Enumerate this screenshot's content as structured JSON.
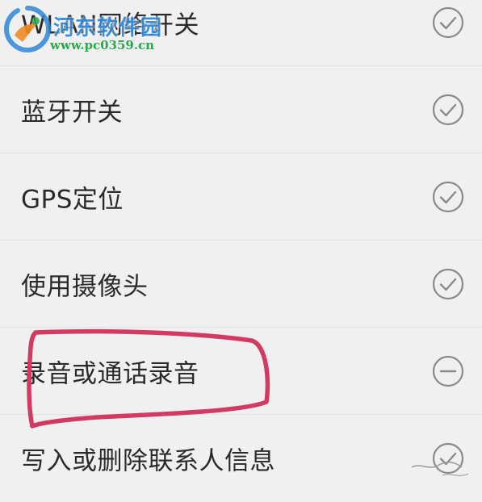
{
  "permissions": {
    "items": [
      {
        "label": "WLAN网络开关",
        "status": "allowed",
        "icon": "check-circle-icon"
      },
      {
        "label": "蓝牙开关",
        "status": "allowed",
        "icon": "check-circle-icon"
      },
      {
        "label": "GPS定位",
        "status": "allowed",
        "icon": "check-circle-icon"
      },
      {
        "label": "使用摄像头",
        "status": "allowed",
        "icon": "check-circle-icon"
      },
      {
        "label": "录音或通话录音",
        "status": "denied",
        "icon": "minus-circle-icon"
      },
      {
        "label": "写入或删除联系人信息",
        "status": "allowed",
        "icon": "check-circle-icon"
      }
    ]
  },
  "watermark": {
    "name": "河东软件园",
    "url": "www.pc0359.cn"
  },
  "colors": {
    "background": "#f0f0f0",
    "divider": "#e2e2e2",
    "icon": "#8a8a8a",
    "annotation": "#d23a63",
    "watermark_blue": "#2f86d6",
    "watermark_green": "#27a84a"
  }
}
